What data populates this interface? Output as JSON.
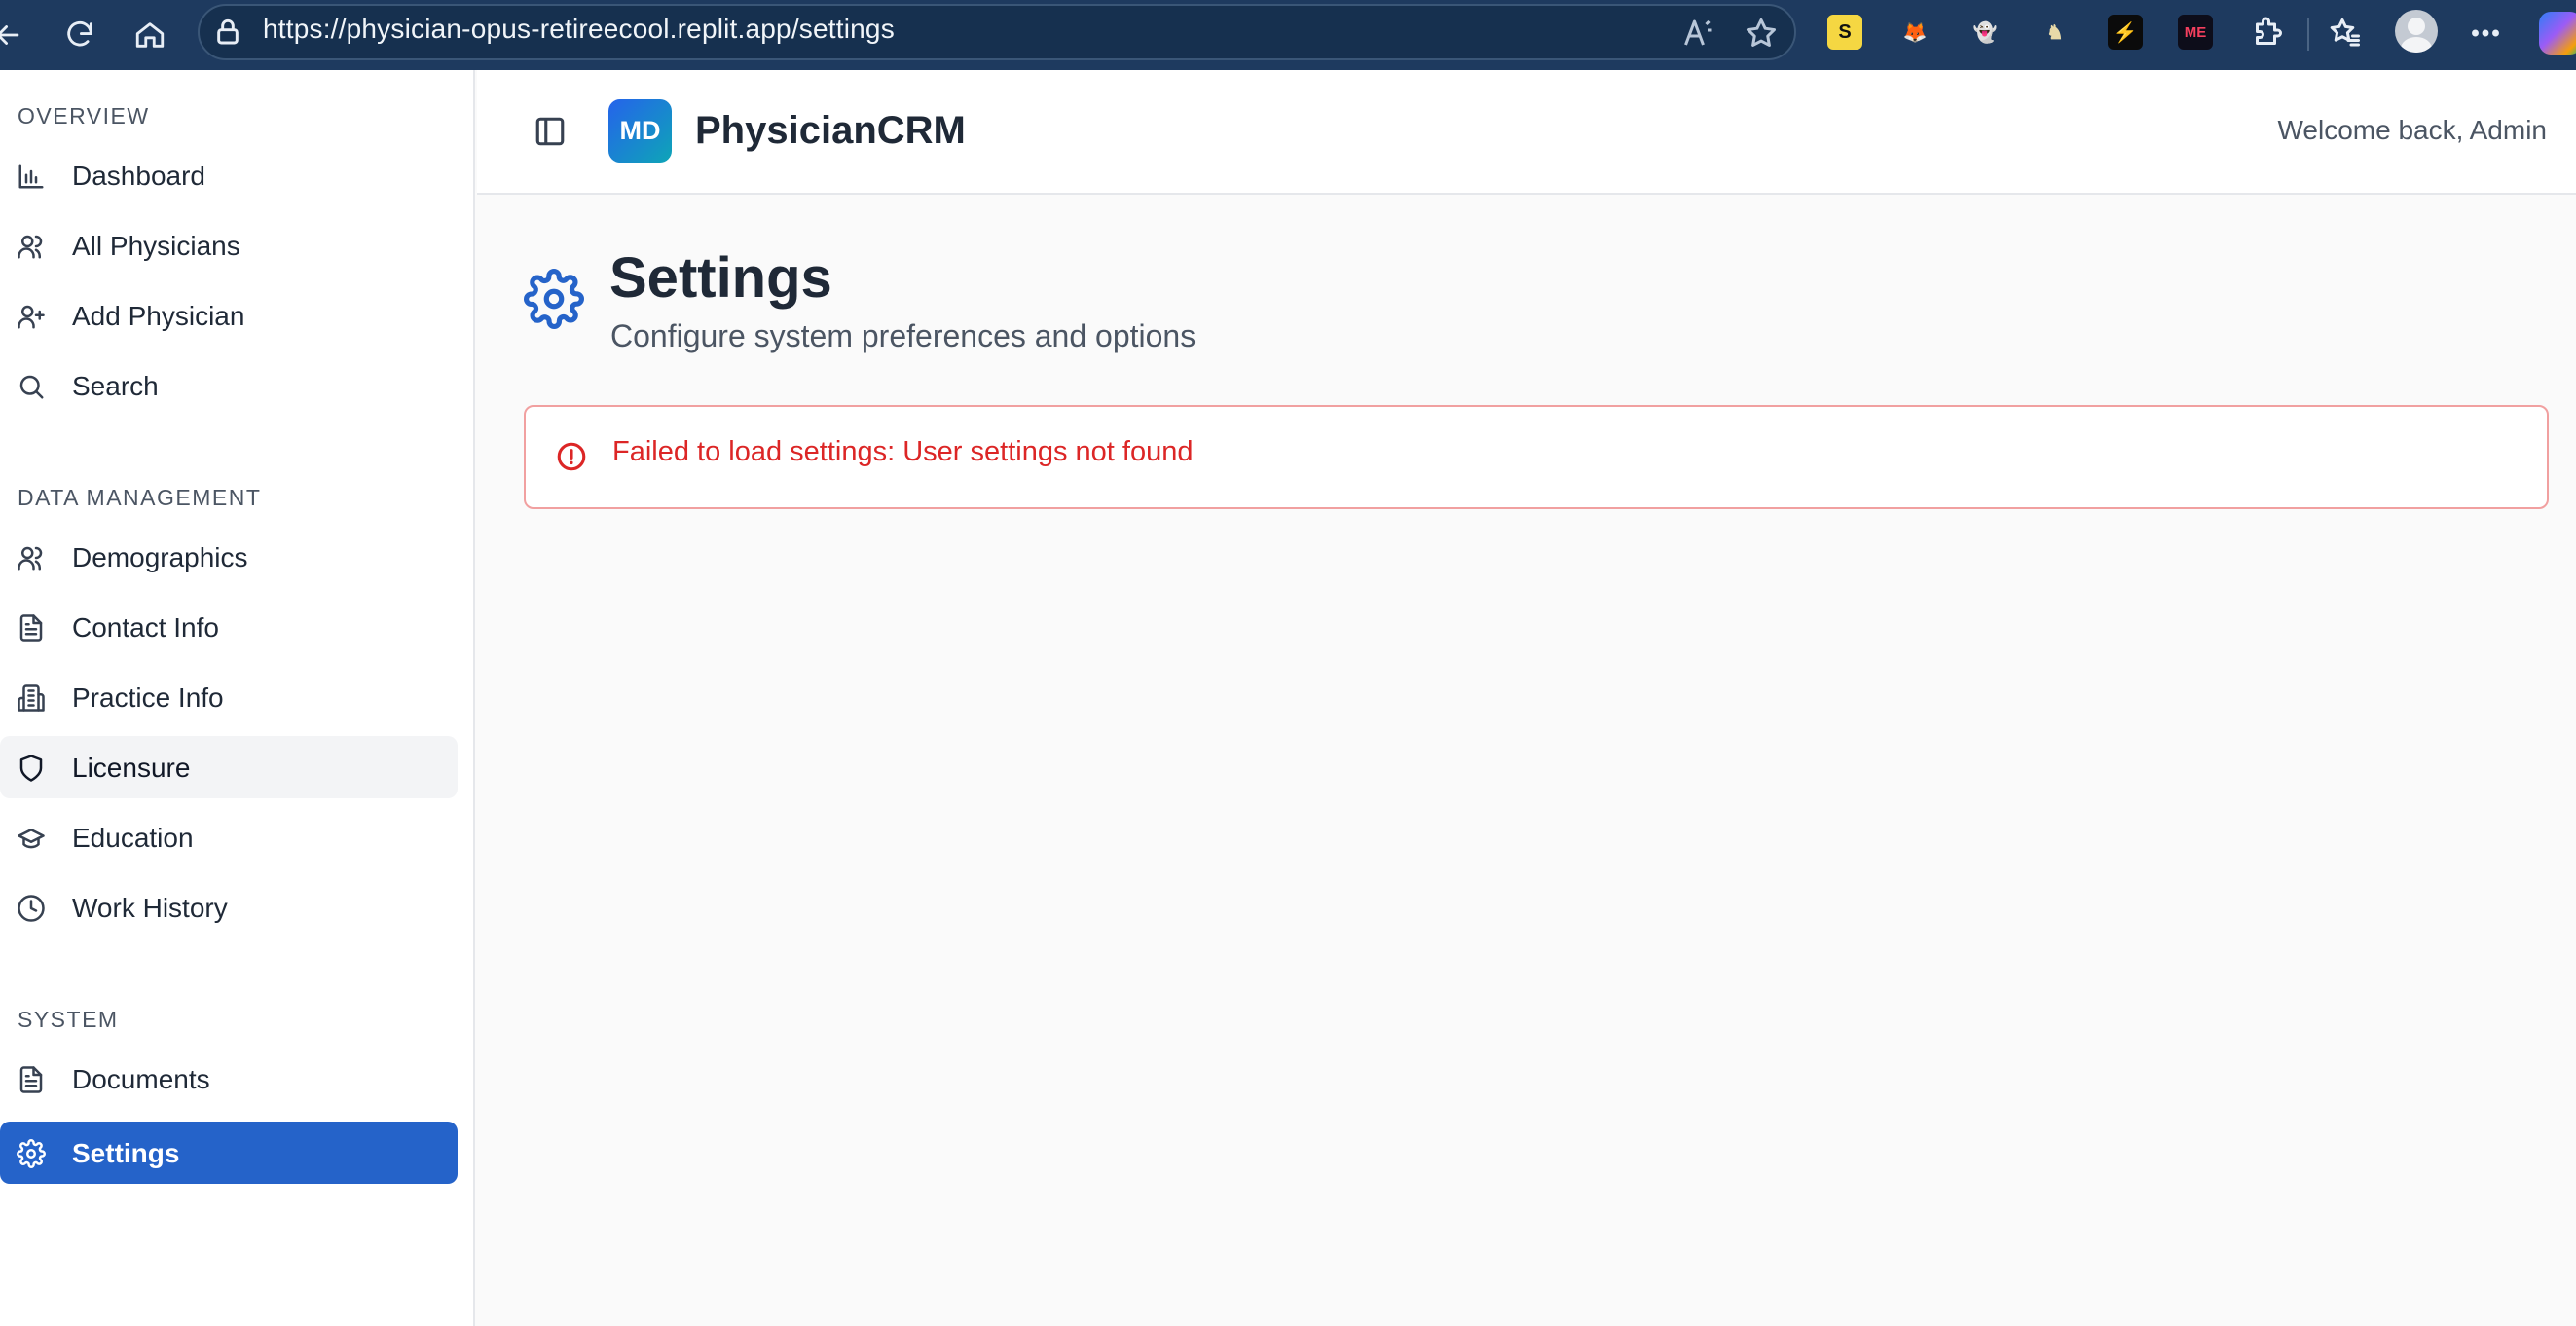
{
  "browser": {
    "url": "https://physician-opus-retireecool.replit.app/settings",
    "extensions": [
      {
        "name": "s-extension-icon",
        "glyph": "S",
        "bg": "#f5d742",
        "fg": "#111111"
      },
      {
        "name": "fox-extension-icon",
        "glyph": "🦊",
        "bg": "transparent",
        "fg": "#e8822c"
      },
      {
        "name": "ghost-extension-icon",
        "glyph": "👻",
        "bg": "transparent",
        "fg": "#9a8cf0"
      },
      {
        "name": "chess-extension-icon",
        "glyph": "♞",
        "bg": "transparent",
        "fg": "#e8d9a8"
      },
      {
        "name": "link-extension-icon",
        "glyph": "⚡",
        "bg": "#0b0b0b",
        "fg": "#ffffff"
      },
      {
        "name": "me-extension-icon",
        "glyph": "ME",
        "bg": "#0d0d1a",
        "fg": "#f43f5e"
      }
    ]
  },
  "sidebar": {
    "sections": [
      {
        "label": "OVERVIEW",
        "items": [
          {
            "label": "Dashboard",
            "icon": "bar-chart-icon"
          },
          {
            "label": "All Physicians",
            "icon": "users-icon"
          },
          {
            "label": "Add Physician",
            "icon": "user-plus-icon"
          },
          {
            "label": "Search",
            "icon": "search-icon"
          }
        ]
      },
      {
        "label": "DATA MANAGEMENT",
        "items": [
          {
            "label": "Demographics",
            "icon": "users-icon"
          },
          {
            "label": "Contact Info",
            "icon": "file-text-icon"
          },
          {
            "label": "Practice Info",
            "icon": "building-icon"
          },
          {
            "label": "Licensure",
            "icon": "shield-icon"
          },
          {
            "label": "Education",
            "icon": "graduation-cap-icon"
          },
          {
            "label": "Work History",
            "icon": "clock-icon"
          }
        ]
      },
      {
        "label": "SYSTEM",
        "items": [
          {
            "label": "Documents",
            "icon": "file-text-icon"
          },
          {
            "label": "Settings",
            "icon": "gear-icon"
          }
        ]
      }
    ],
    "hovered_item": "Licensure",
    "active_item": "Settings"
  },
  "header": {
    "logo_text": "MD",
    "app_name": "PhysicianCRM",
    "welcome": "Welcome back, Admin"
  },
  "page": {
    "title": "Settings",
    "subtitle": "Configure system preferences and options",
    "error_message": "Failed to load settings: User settings not found"
  },
  "colors": {
    "accent": "#2563c9",
    "error": "#dc2626",
    "browser_bar": "#1e3a5f"
  }
}
